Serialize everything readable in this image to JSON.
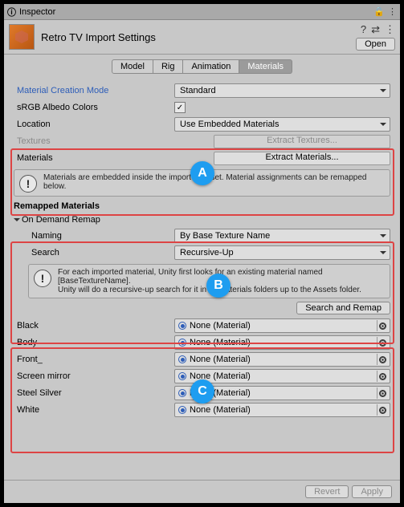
{
  "titlebar": {
    "title": "Inspector",
    "lock_icon": "lock-icon",
    "menu_icon": "vdots-icon"
  },
  "header": {
    "title": "Retro TV Import Settings",
    "help_icon": "?",
    "preset_icon": "⇄",
    "menu_icon": "⋮",
    "open_button": "Open"
  },
  "tabs": [
    "Model",
    "Rig",
    "Animation",
    "Materials"
  ],
  "active_tab": 3,
  "fields": {
    "material_creation_mode": {
      "label": "Material Creation Mode",
      "value": "Standard"
    },
    "srgb": {
      "label": "sRGB Albedo Colors",
      "checked": true
    },
    "location": {
      "label": "Location",
      "value": "Use Embedded Materials"
    },
    "textures": {
      "label": "Textures",
      "button": "Extract Textures..."
    },
    "materials": {
      "label": "Materials",
      "button": "Extract Materials..."
    }
  },
  "embed_info": "Materials are embedded inside the imported asset. Material assignments can be remapped below.",
  "remapped_header": "Remapped Materials",
  "on_demand_header": "On Demand Remap",
  "naming": {
    "label": "Naming",
    "value": "By Base Texture Name"
  },
  "search": {
    "label": "Search",
    "value": "Recursive-Up"
  },
  "remap_info": "For each imported material, Unity first looks for an existing material named [BaseTextureName].\nUnity will do a recursive-up search for it in all Materials folders up to the Assets folder.",
  "search_remap_button": "Search and Remap",
  "material_slots": [
    {
      "name": "Black",
      "value": "None (Material)"
    },
    {
      "name": "Body",
      "value": "None (Material)"
    },
    {
      "name": "Front_",
      "value": "None (Material)"
    },
    {
      "name": "Screen mirror",
      "value": "None (Material)"
    },
    {
      "name": "Steel Silver",
      "value": "None (Material)"
    },
    {
      "name": "White",
      "value": "None (Material)"
    }
  ],
  "footer": {
    "revert": "Revert",
    "apply": "Apply"
  },
  "markers": {
    "a": "A",
    "b": "B",
    "c": "C"
  }
}
